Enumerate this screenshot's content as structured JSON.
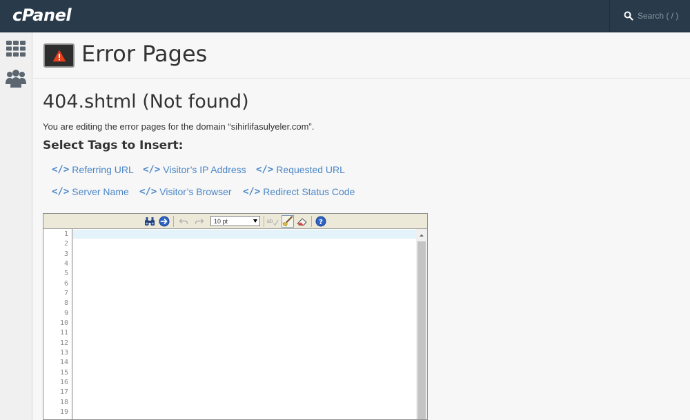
{
  "topbar": {
    "logo_text": "cPanel",
    "search_placeholder": "Search ( / )"
  },
  "sidebar": {
    "items": [
      {
        "name": "home",
        "icon": "grid-icon"
      },
      {
        "name": "users",
        "icon": "users-icon"
      }
    ]
  },
  "header": {
    "title": "Error Pages",
    "icon": "warning-icon"
  },
  "main": {
    "section_title": "404.shtml (Not found)",
    "domain_info": "You are editing the error pages for the domain “sihirlifasulyeler.com”.",
    "tags_title": "Select Tags to Insert:",
    "tags": [
      "Referring URL",
      "Visitor’s IP Address",
      "Requested URL",
      "Server Name",
      "Visitor’s Browser",
      "Redirect Status Code"
    ]
  },
  "editor": {
    "font_size": "10 pt",
    "line_numbers": [
      "1",
      "2",
      "3",
      "4",
      "5",
      "6",
      "7",
      "8",
      "9",
      "10",
      "11",
      "12",
      "13",
      "14",
      "15",
      "16",
      "17",
      "18",
      "19"
    ]
  },
  "colors": {
    "topbar": "#293a4a",
    "link": "#4a86c6",
    "active_line": "#e4f3f9"
  }
}
